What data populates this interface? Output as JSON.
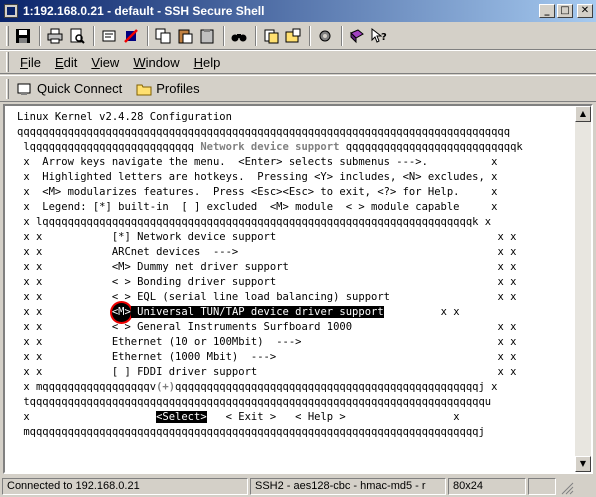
{
  "window": {
    "title": "1:192.168.0.21 - default - SSH Secure Shell",
    "min": "_",
    "max": "□",
    "close": "✕"
  },
  "menubar": {
    "items": [
      {
        "key": "F",
        "rest": "ile"
      },
      {
        "key": "E",
        "rest": "dit"
      },
      {
        "key": "V",
        "rest": "iew"
      },
      {
        "key": "W",
        "rest": "indow"
      },
      {
        "key": "H",
        "rest": "elp"
      }
    ]
  },
  "quickbar": {
    "quick_connect": "Quick Connect",
    "profiles": "Profiles"
  },
  "terminal": {
    "header": "Linux Kernel v2.4.28 Configuration",
    "top_border": "qqqqqqqqqqqqqqqqqqqqqqqqqqqqqqqqqqqqqqqqqqqqqqqqqqqqqqqqqqqqqqqqqqqqqqqqqqqqqq",
    "title_left": " lqqqqqqqqqqqqqqqqqqqqqqqqqq ",
    "title": "Network device support",
    "title_right": " qqqqqqqqqqqqqqqqqqqqqqqqqqqk",
    "help1": " x  Arrow keys navigate the menu.  <Enter> selects submenus --->.          x",
    "help2": " x  Highlighted letters are hotkeys.  Pressing <Y> includes, <N> excludes, x",
    "help3": " x  <M> modularizes features.  Press <Esc><Esc> to exit, <?> for Help.     x",
    "help4": " x  Legend: [*] built-in  [ ] excluded  <M> module  < > module capable     x",
    "inner_top": " x lqqqqqqqqqqqqqqqqqqqqqqqqqqqqqqqqqqqqqqqqqqqqqqqqqqqqqqqqqqqqqqqqqqqqk x",
    "items": [
      {
        "prefix": " x x           ",
        "text": "[*] Network device support",
        "suffix": "                                   x x"
      },
      {
        "prefix": " x x           ",
        "text": "ARCnet devices  --->",
        "suffix": "                                         x x"
      },
      {
        "prefix": " x x           ",
        "text": "<M> Dummy net driver support",
        "suffix": "                                 x x"
      },
      {
        "prefix": " x x           ",
        "text": "< > Bonding driver support",
        "suffix": "                                   x x"
      },
      {
        "prefix": " x x           ",
        "text": "< > EQL (serial line load balancing) support",
        "suffix": "                 x x"
      },
      {
        "prefix": " x x           ",
        "marker": "<M>",
        "text": " Universal TUN/TAP device driver support",
        "suffix": "         x x",
        "selected": true
      },
      {
        "prefix": " x x           ",
        "text": "< > General Instruments Surfboard 1000",
        "suffix": "                       x x"
      },
      {
        "prefix": " x x           ",
        "text": "Ethernet (10 or 100Mbit)  --->",
        "suffix": "                               x x"
      },
      {
        "prefix": " x x           ",
        "text": "Ethernet (1000 Mbit)  --->",
        "suffix": "                                   x x"
      },
      {
        "prefix": " x x           ",
        "text": "[ ] FDDI driver support",
        "suffix": "                                      x x"
      }
    ],
    "inner_bottom_left": " x mqqqqqqqqqqqqqqqqqv",
    "inner_bottom_mid": "(+)",
    "inner_bottom_right": "qqqqqqqqqqqqqqqqqqqqqqqqqqqqqqqqqqqqqqqqqqqqqqqqj x",
    "sep_line": " tqqqqqqqqqqqqqqqqqqqqqqqqqqqqqqqqqqqqqqqqqqqqqqqqqqqqqqqqqqqqqqqqqqqqqqqqu",
    "buttons_pre": " x                    ",
    "btn_select": "<Select>",
    "btn_exit": "< Exit >",
    "btn_help": "< Help >",
    "buttons_post": "                 x",
    "bottom_border": " mqqqqqqqqqqqqqqqqqqqqqqqqqqqqqqqqqqqqqqqqqqqqqqqqqqqqqqqqqqqqqqqqqqqqqqqj"
  },
  "statusbar": {
    "connection": "Connected to 192.168.0.21",
    "cipher": "SSH2 - aes128-cbc - hmac-md5 - r",
    "size": "80x24"
  },
  "colors": {
    "titlebar_start": "#0a246a",
    "titlebar_end": "#a6caf0",
    "chrome": "#d4d0c8",
    "marker_ring": "#e00000"
  }
}
